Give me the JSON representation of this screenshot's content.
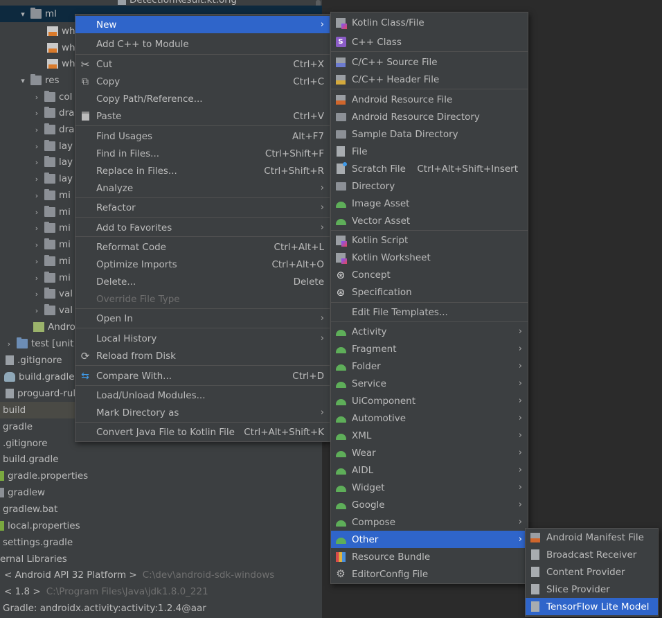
{
  "tree": {
    "rows": [
      {
        "label": "DetectionResult.kt.orig",
        "path": ""
      },
      {
        "label": "ml",
        "path": ""
      },
      {
        "label": "wh",
        "path": ""
      },
      {
        "label": "wh",
        "path": ""
      },
      {
        "label": "wh",
        "path": ""
      },
      {
        "label": "res",
        "path": ""
      },
      {
        "label": "col",
        "path": ""
      },
      {
        "label": "dra",
        "path": ""
      },
      {
        "label": "dra",
        "path": ""
      },
      {
        "label": "lay",
        "path": ""
      },
      {
        "label": "lay",
        "path": ""
      },
      {
        "label": "lay",
        "path": ""
      },
      {
        "label": "mi",
        "path": ""
      },
      {
        "label": "mi",
        "path": ""
      },
      {
        "label": "mi",
        "path": ""
      },
      {
        "label": "mi",
        "path": ""
      },
      {
        "label": "mi",
        "path": ""
      },
      {
        "label": "mi",
        "path": ""
      },
      {
        "label": "val",
        "path": ""
      },
      {
        "label": "val",
        "path": ""
      },
      {
        "label": "Andro",
        "path": ""
      },
      {
        "label": "test",
        "bold": "[unit",
        "path": ""
      },
      {
        "label": ".gitignore",
        "path": ""
      },
      {
        "label": "build.gradle",
        "path": ""
      },
      {
        "label": "proguard-rul",
        "path": ""
      },
      {
        "label": "build",
        "path": ""
      },
      {
        "label": "gradle",
        "path": ""
      },
      {
        "label": ".gitignore",
        "path": ""
      },
      {
        "label": "build.gradle",
        "path": ""
      },
      {
        "label": "gradle.properties",
        "path": ""
      },
      {
        "label": "gradlew",
        "path": ""
      },
      {
        "label": "gradlew.bat",
        "path": ""
      },
      {
        "label": "local.properties",
        "path": ""
      },
      {
        "label": "settings.gradle",
        "path": ""
      },
      {
        "label": "ernal Libraries",
        "path": ""
      },
      {
        "label": "< Android API 32 Platform >",
        "path": "C:\\dev\\android-sdk-windows"
      },
      {
        "label": "< 1.8 >",
        "path": "C:\\Program Files\\Java\\jdk1.8.0_221"
      },
      {
        "label": "Gradle: androidx.activity:activity:1.2.4@aar",
        "path": ""
      }
    ]
  },
  "context_menu": {
    "items": [
      {
        "label": "New",
        "shortcut": "",
        "submenu": true
      },
      {
        "label": "Add C++ to Module",
        "shortcut": ""
      },
      {
        "label": "Cut",
        "shortcut": "Ctrl+X",
        "icon": "scissors-icon"
      },
      {
        "label": "Copy",
        "shortcut": "Ctrl+C",
        "icon": "copy-icon"
      },
      {
        "label": "Copy Path/Reference...",
        "shortcut": ""
      },
      {
        "label": "Paste",
        "shortcut": "Ctrl+V",
        "icon": "paste-icon"
      },
      {
        "label": "Find Usages",
        "shortcut": "Alt+F7"
      },
      {
        "label": "Find in Files...",
        "shortcut": "Ctrl+Shift+F"
      },
      {
        "label": "Replace in Files...",
        "shortcut": "Ctrl+Shift+R"
      },
      {
        "label": "Analyze",
        "shortcut": "",
        "submenu": true
      },
      {
        "label": "Refactor",
        "shortcut": "",
        "submenu": true
      },
      {
        "label": "Add to Favorites",
        "shortcut": "",
        "submenu": true
      },
      {
        "label": "Reformat Code",
        "shortcut": "Ctrl+Alt+L"
      },
      {
        "label": "Optimize Imports",
        "shortcut": "Ctrl+Alt+O"
      },
      {
        "label": "Delete...",
        "shortcut": "Delete"
      },
      {
        "label": "Override File Type",
        "shortcut": "",
        "disabled": true
      },
      {
        "label": "Open In",
        "shortcut": "",
        "submenu": true
      },
      {
        "label": "Local History",
        "shortcut": "",
        "submenu": true
      },
      {
        "label": "Reload from Disk",
        "shortcut": "",
        "icon": "reload-icon"
      },
      {
        "label": "Compare With...",
        "shortcut": "Ctrl+D",
        "icon": "compare-icon"
      },
      {
        "label": "Load/Unload Modules...",
        "shortcut": ""
      },
      {
        "label": "Mark Directory as",
        "shortcut": "",
        "submenu": true
      },
      {
        "label": "Convert Java File to Kotlin File",
        "shortcut": "Ctrl+Alt+Shift+K"
      }
    ]
  },
  "new_menu": {
    "items": [
      {
        "label": "Kotlin Class/File",
        "icon": "kotlin-file-icon"
      },
      {
        "label": "C++ Class",
        "icon": "cpp-class-icon",
        "icon_text": "S"
      },
      {
        "label": "C/C++ Source File",
        "icon": "cpp-source-icon"
      },
      {
        "label": "C/C++ Header File",
        "icon": "cpp-header-icon"
      },
      {
        "label": "Android Resource File",
        "icon": "android-resource-file-icon"
      },
      {
        "label": "Android Resource Directory",
        "icon": "folder-icon"
      },
      {
        "label": "Sample Data Directory",
        "icon": "folder-icon"
      },
      {
        "label": "File",
        "icon": "file-icon"
      },
      {
        "label": "Scratch File",
        "shortcut": "Ctrl+Alt+Shift+Insert",
        "icon": "scratch-file-icon"
      },
      {
        "label": "Directory",
        "icon": "folder-icon"
      },
      {
        "label": "Image Asset",
        "icon": "android-icon"
      },
      {
        "label": "Vector Asset",
        "icon": "android-icon"
      },
      {
        "label": "Kotlin Script",
        "icon": "kotlin-script-icon"
      },
      {
        "label": "Kotlin Worksheet",
        "icon": "kotlin-worksheet-icon"
      },
      {
        "label": "Concept",
        "icon": "mps-icon"
      },
      {
        "label": "Specification",
        "icon": "mps-icon"
      },
      {
        "label": "Edit File Templates..."
      },
      {
        "label": "Activity",
        "icon": "android-icon",
        "submenu": true
      },
      {
        "label": "Fragment",
        "icon": "android-icon",
        "submenu": true
      },
      {
        "label": "Folder",
        "icon": "android-icon",
        "submenu": true
      },
      {
        "label": "Service",
        "icon": "android-icon",
        "submenu": true
      },
      {
        "label": "UiComponent",
        "icon": "android-icon",
        "submenu": true
      },
      {
        "label": "Automotive",
        "icon": "android-icon",
        "submenu": true
      },
      {
        "label": "XML",
        "icon": "android-icon",
        "submenu": true
      },
      {
        "label": "Wear",
        "icon": "android-icon",
        "submenu": true
      },
      {
        "label": "AIDL",
        "icon": "android-icon",
        "submenu": true
      },
      {
        "label": "Widget",
        "icon": "android-icon",
        "submenu": true
      },
      {
        "label": "Google",
        "icon": "android-icon",
        "submenu": true
      },
      {
        "label": "Compose",
        "icon": "android-icon",
        "submenu": true
      },
      {
        "label": "Other",
        "icon": "android-icon",
        "submenu": true
      },
      {
        "label": "Resource Bundle",
        "icon": "resource-bundle-icon"
      },
      {
        "label": "EditorConfig File",
        "icon": "gear-icon"
      }
    ]
  },
  "other_menu": {
    "items": [
      {
        "label": "Android Manifest File"
      },
      {
        "label": "Broadcast Receiver"
      },
      {
        "label": "Content Provider"
      },
      {
        "label": "Slice Provider"
      },
      {
        "label": "TensorFlow Lite Model"
      }
    ]
  },
  "colors": {
    "selection": "#2f65ca",
    "menu_bg": "#3c3f41",
    "text": "#bbbbbb",
    "android_green": "#5eae59"
  }
}
